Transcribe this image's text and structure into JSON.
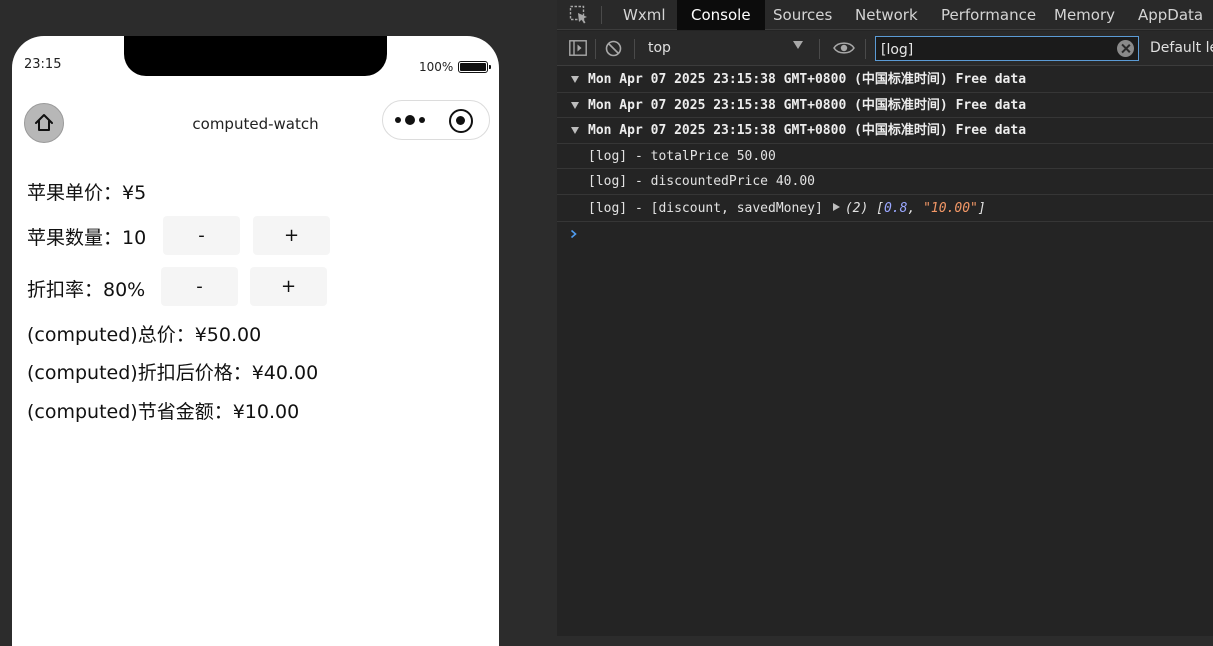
{
  "simulator": {
    "status_time": "23:15",
    "battery_pct": "100%",
    "nav_title": "computed-watch",
    "rows": {
      "unit_price": "苹果单价：¥5",
      "quantity": "苹果数量：10",
      "discount_rate": "折扣率：80%",
      "total_price": "(computed)总价：¥50.00",
      "discounted_price": "(computed)折扣后价格：¥40.00",
      "saved_money": "(computed)节省金额：¥10.00"
    },
    "buttons": {
      "minus": "-",
      "plus": "+"
    }
  },
  "devtools": {
    "tabs": [
      "Wxml",
      "Console",
      "Sources",
      "Network",
      "Performance",
      "Memory",
      "AppData"
    ],
    "active_tab": "Console",
    "context": "top",
    "filter_value": "[log]",
    "levels_label": "Default le",
    "console": {
      "groups": [
        "Mon Apr 07 2025 23:15:38 GMT+0800 (中国标准时间) Free data",
        "Mon Apr 07 2025 23:15:38 GMT+0800 (中国标准时间) Free data",
        "Mon Apr 07 2025 23:15:38 GMT+0800 (中国标准时间) Free data"
      ],
      "logs": [
        "[log] - totalPrice 50.00",
        "[log] - discountedPrice 40.00"
      ],
      "array_log": {
        "prefix": "[log] - [discount, savedMoney]",
        "length": "(2)",
        "open": "[",
        "num": "0.8",
        "comma": ", ",
        "str": "\"10.00\"",
        "close": "]"
      }
    }
  }
}
